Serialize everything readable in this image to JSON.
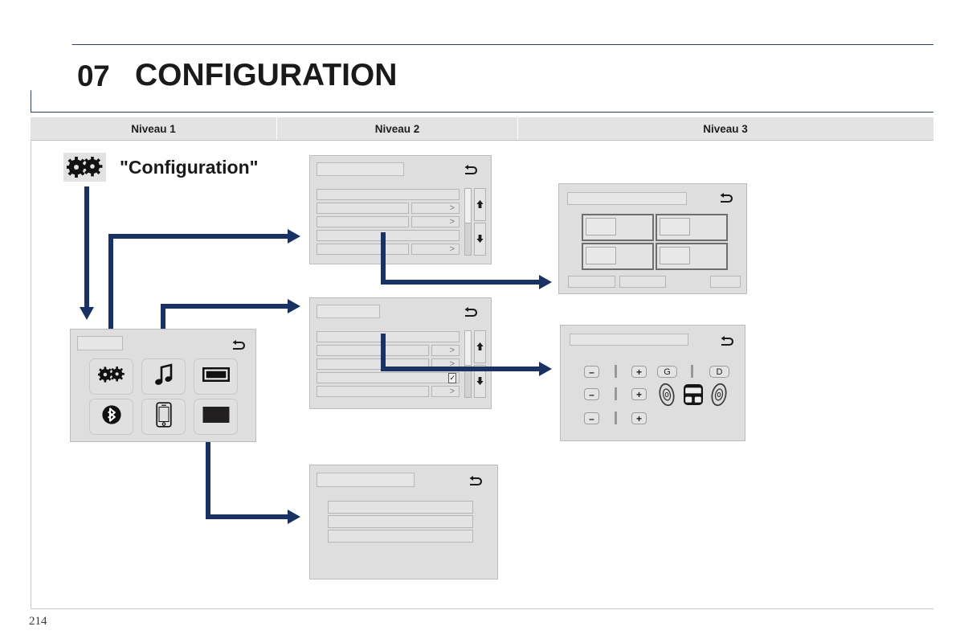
{
  "document": {
    "chapter_number": "07",
    "chapter_title": "CONFIGURATION",
    "page_number": "214"
  },
  "levels_header": {
    "level1": "Niveau 1",
    "level2": "Niveau 2",
    "level3": "Niveau 3"
  },
  "config_entry": {
    "icon": "gears-icon",
    "label": "\"Configuration\""
  },
  "main_menu_panel": {
    "name": "configuration-main-menu-screen",
    "back_icon": "return-arrow-icon",
    "title_field": "",
    "tiles": [
      {
        "icon": "gears-icon",
        "name": "tile-configuration"
      },
      {
        "icon": "music-note-icon",
        "name": "tile-audio"
      },
      {
        "icon": "display-screen-icon",
        "name": "tile-display"
      },
      {
        "icon": "bluetooth-icon",
        "name": "tile-bluetooth"
      },
      {
        "icon": "smartphone-icon",
        "name": "tile-phone-mirroring"
      },
      {
        "icon": "black-rectangle-icon",
        "name": "tile-screen-off"
      }
    ]
  },
  "list_panel_top": {
    "name": "configuration-options-list-screen",
    "back_icon": "return-arrow-icon",
    "title_field": "",
    "rows": [
      {
        "label": "",
        "chevron": ">",
        "has_chevron": false
      },
      {
        "label": "",
        "chevron": ">",
        "has_chevron": true
      },
      {
        "label": "",
        "chevron": ">",
        "has_chevron": true
      },
      {
        "label": "",
        "chevron": ">",
        "has_chevron": false
      },
      {
        "label": "",
        "chevron": ">",
        "has_chevron": true
      }
    ],
    "scrollbar": {
      "up_arrow": "▲",
      "down_arrow": "▼"
    }
  },
  "list_panel_middle": {
    "name": "display-options-list-screen",
    "back_icon": "return-arrow-icon",
    "title_field": "",
    "rows": [
      {
        "label": "",
        "chevron": ">",
        "has_chevron": false,
        "has_checkbox": false
      },
      {
        "label": "",
        "chevron": ">",
        "has_chevron": true,
        "has_checkbox": false
      },
      {
        "label": "",
        "chevron": ">",
        "has_chevron": true,
        "has_checkbox": false
      },
      {
        "label": "",
        "chevron": "",
        "has_chevron": false,
        "has_checkbox": true,
        "checkbox_glyph": "✓"
      },
      {
        "label": "",
        "chevron": ">",
        "has_chevron": true,
        "has_checkbox": false
      }
    ],
    "scrollbar": {
      "up_arrow": "▲",
      "down_arrow": "▼"
    }
  },
  "list_panel_bottom": {
    "name": "simple-options-screen",
    "back_icon": "return-arrow-icon",
    "title_field": "",
    "rows": [
      "",
      "",
      ""
    ]
  },
  "quad_panel": {
    "name": "display-settings-screen",
    "back_icon": "return-arrow-icon",
    "title_field": "",
    "tiles": [
      "",
      "",
      "",
      ""
    ],
    "bottom_buttons": [
      "",
      "",
      ""
    ]
  },
  "audio_panel": {
    "name": "audio-balance-settings-screen",
    "back_icon": "return-arrow-icon",
    "title_field": "",
    "steppers": [
      {
        "minus": "–",
        "plus": "+"
      },
      {
        "minus": "–",
        "plus": "+"
      },
      {
        "minus": "–",
        "plus": "+"
      }
    ],
    "balance_left_label": "G",
    "balance_right_label": "D",
    "speaker_icons": [
      "speaker-left-icon",
      "car-seat-icon",
      "speaker-right-icon"
    ]
  },
  "connectors": {
    "color": "#1a3263",
    "arrows": [
      {
        "name": "config-label-to-main-menu",
        "direction": "down"
      },
      {
        "name": "menu-gears-to-list-top",
        "direction": "right"
      },
      {
        "name": "menu-music-to-list-middle",
        "direction": "right"
      },
      {
        "name": "list-top-to-quad-panel",
        "direction": "right"
      },
      {
        "name": "list-middle-to-audio-panel",
        "direction": "right"
      },
      {
        "name": "menu-blackrect-to-list-bottom",
        "direction": "right"
      }
    ]
  }
}
